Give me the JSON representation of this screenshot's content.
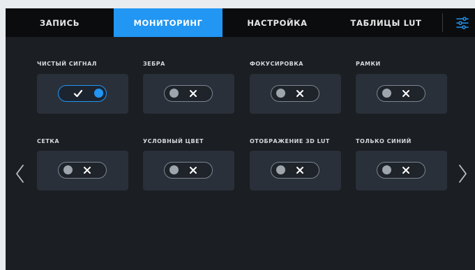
{
  "tabs": [
    {
      "label": "ЗАПИСЬ",
      "active": false
    },
    {
      "label": "МОНИТОРИНГ",
      "active": true
    },
    {
      "label": "НАСТРОЙКА",
      "active": false
    },
    {
      "label": "ТАБЛИЦЫ LUT",
      "active": false
    }
  ],
  "menu_icon": "settings-sliders-icon",
  "colors": {
    "accent": "#2196f3",
    "background": "#1b1e22",
    "panel": "#2a3039",
    "tabbar": "#0b0c0e"
  },
  "settings": [
    {
      "label": "ЧИСТЫЙ СИГНАЛ",
      "enabled": true
    },
    {
      "label": "ЗЕБРА",
      "enabled": false
    },
    {
      "label": "ФОКУСИРОВКА",
      "enabled": false
    },
    {
      "label": "РАМКИ",
      "enabled": false
    },
    {
      "label": "СЕТКА",
      "enabled": false
    },
    {
      "label": "УСЛОВНЫЙ ЦВЕТ",
      "enabled": false
    },
    {
      "label": "ОТОБРАЖЕНИЕ 3D LUT",
      "enabled": false
    },
    {
      "label": "ТОЛЬКО СИНИЙ",
      "enabled": false
    }
  ],
  "nav": {
    "prev_icon": "chevron-left-icon",
    "next_icon": "chevron-right-icon"
  }
}
